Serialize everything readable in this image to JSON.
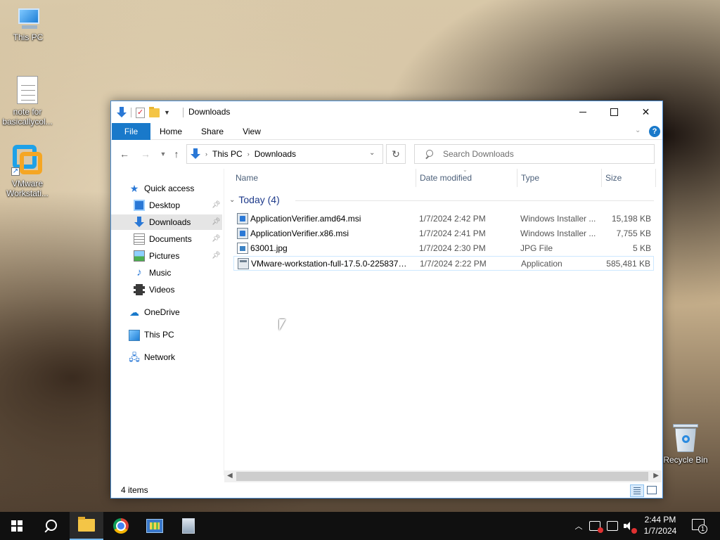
{
  "desktop": {
    "icons": [
      {
        "label": "This PC",
        "icon": "this-pc-icon"
      },
      {
        "label": "note for basicallycol...",
        "icon": "text-document-icon"
      },
      {
        "label": "VMware Workstati...",
        "icon": "vmware-icon"
      },
      {
        "label": "Recycle Bin",
        "icon": "recycle-bin-icon"
      }
    ]
  },
  "window": {
    "title": "Downloads",
    "ribbon_tabs": [
      "File",
      "Home",
      "Share",
      "View"
    ],
    "help_label": "?",
    "address": {
      "crumbs": [
        "This PC",
        "Downloads"
      ]
    },
    "search": {
      "placeholder": "Search Downloads"
    },
    "nav_pane": [
      {
        "label": "Quick access",
        "icon": "quick-access-star-icon",
        "pinned": false
      },
      {
        "label": "Desktop",
        "icon": "desktop-folder-icon",
        "pinned": true
      },
      {
        "label": "Downloads",
        "icon": "downloads-icon",
        "pinned": true,
        "selected": true
      },
      {
        "label": "Documents",
        "icon": "documents-icon",
        "pinned": true
      },
      {
        "label": "Pictures",
        "icon": "pictures-icon",
        "pinned": true
      },
      {
        "label": "Music",
        "icon": "music-icon",
        "pinned": false
      },
      {
        "label": "Videos",
        "icon": "videos-icon",
        "pinned": false
      },
      {
        "label": "OneDrive",
        "icon": "onedrive-cloud-icon",
        "pinned": false
      },
      {
        "label": "This PC",
        "icon": "this-pc-icon",
        "pinned": false
      },
      {
        "label": "Network",
        "icon": "network-icon",
        "pinned": false
      }
    ],
    "columns": [
      "Name",
      "Date modified",
      "Type",
      "Size"
    ],
    "group_label": "Today (4)",
    "files": [
      {
        "name": "ApplicationVerifier.amd64.msi",
        "date": "1/7/2024 2:42 PM",
        "type": "Windows Installer ...",
        "size": "15,198 KB",
        "icon": "msi-installer-icon"
      },
      {
        "name": "ApplicationVerifier.x86.msi",
        "date": "1/7/2024 2:41 PM",
        "type": "Windows Installer ...",
        "size": "7,755 KB",
        "icon": "msi-installer-icon"
      },
      {
        "name": "63001.jpg",
        "date": "1/7/2024 2:30 PM",
        "type": "JPG File",
        "size": "5 KB",
        "icon": "jpg-image-icon"
      },
      {
        "name": "VMware-workstation-full-17.5.0-2258379...",
        "date": "1/7/2024 2:22 PM",
        "type": "Application",
        "size": "585,481 KB",
        "icon": "application-exe-icon",
        "selected": true
      }
    ],
    "status": {
      "item_count": "4 items"
    }
  },
  "taskbar": {
    "clock_time": "2:44 PM",
    "clock_date": "1/7/2024",
    "notification_count": "1",
    "accent": "#76b9ed"
  }
}
